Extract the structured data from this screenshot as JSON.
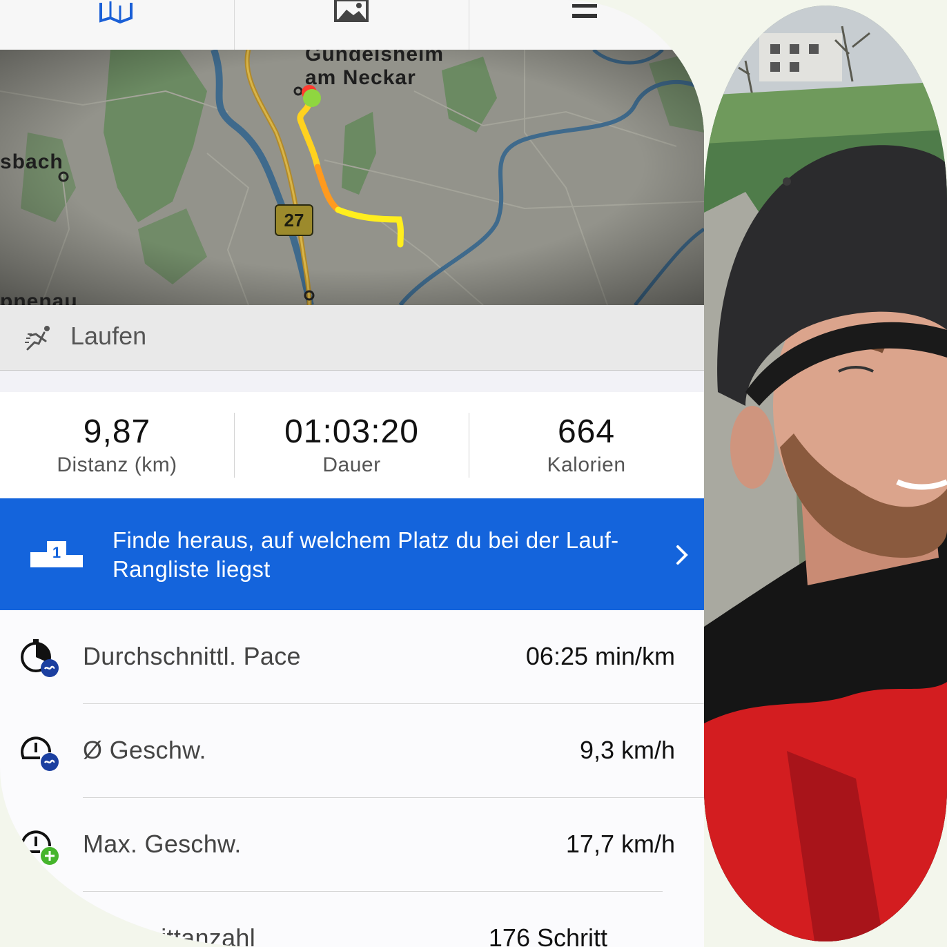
{
  "tabs": [
    {
      "icon": "map-icon"
    },
    {
      "icon": "image-icon"
    },
    {
      "icon": "menu-icon"
    }
  ],
  "map": {
    "labels": {
      "town": "Gundelsheim",
      "town_sub": "am Neckar",
      "left": "sbach",
      "bottom_left": "pnenau"
    },
    "road_number": "27",
    "route_colors": {
      "start": "#ff3b30",
      "end": "#8fd640",
      "path": "#ffee1e",
      "hot": "#ff9a1e"
    }
  },
  "activity": {
    "icon": "running-person-icon",
    "label": "Laufen"
  },
  "stats": [
    {
      "value": "9,87",
      "label": "Distanz (km)"
    },
    {
      "value": "01:03:20",
      "label": "Dauer"
    },
    {
      "value": "664",
      "label": "Kalorien"
    }
  ],
  "banner": {
    "icon": "podium-icon",
    "podium_number": "1",
    "text": "Finde heraus, auf welchem Platz du bei der Lauf-Rangliste liegst",
    "color": "#1464dc"
  },
  "metrics": [
    {
      "icon": "stopwatch-avg-icon",
      "label": "Durchschnittl. Pace",
      "value": "06:25 min/km"
    },
    {
      "icon": "speedometer-avg-icon",
      "label": "Ø Geschw.",
      "value": "9,3 km/h"
    },
    {
      "icon": "speedometer-max-icon",
      "label": "Max. Geschw.",
      "value": "17,7 km/h"
    },
    {
      "icon": "steps-icon",
      "label": "Schrittanzahl",
      "value": "176 Schritt"
    }
  ]
}
